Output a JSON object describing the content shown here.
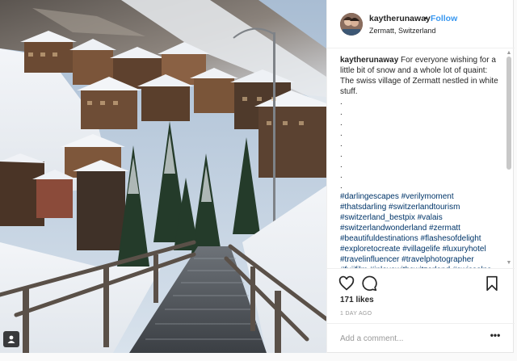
{
  "post": {
    "username": "kaytherunaway",
    "separator": "•",
    "follow_label": "Follow",
    "location": "Zermatt, Switzerland",
    "caption_user": "kaytherunaway",
    "caption_text": "For everyone wishing for a little bit of snow and a whole lot of quaint: The swiss village of Zermatt nestled in white stuff.",
    "caption_dots": [
      ".",
      ".",
      ".",
      ".",
      ".",
      ".",
      ".",
      ".",
      "."
    ],
    "hashtags": [
      "#darlingescapes #verilymoment",
      "#thatsdarling #switzerlandtourism",
      "#switzerland_bestpix #valais",
      "#switzerlandwonderland #zermatt",
      "#beautifuldestinations #flashesofdelight",
      "#exploretocreate #villagelife #luxuryhotel",
      "#travelinfluencer #travelphotographer",
      "#fujifilm #inlovewithswitzerland #swissalps"
    ],
    "likes": "171 likes",
    "time_ago": "1 DAY AGO",
    "comment_placeholder": "Add a comment...",
    "more_label": "•••"
  },
  "icons": {
    "like": "heart-icon",
    "comment": "comment-bubble-icon",
    "save": "bookmark-icon",
    "tag": "user-tag-icon",
    "scroll_up": "▲",
    "scroll_down": "▼"
  },
  "colors": {
    "link_blue": "#3897f0",
    "hashtag_blue": "#003569",
    "meta_gray": "#999999"
  }
}
